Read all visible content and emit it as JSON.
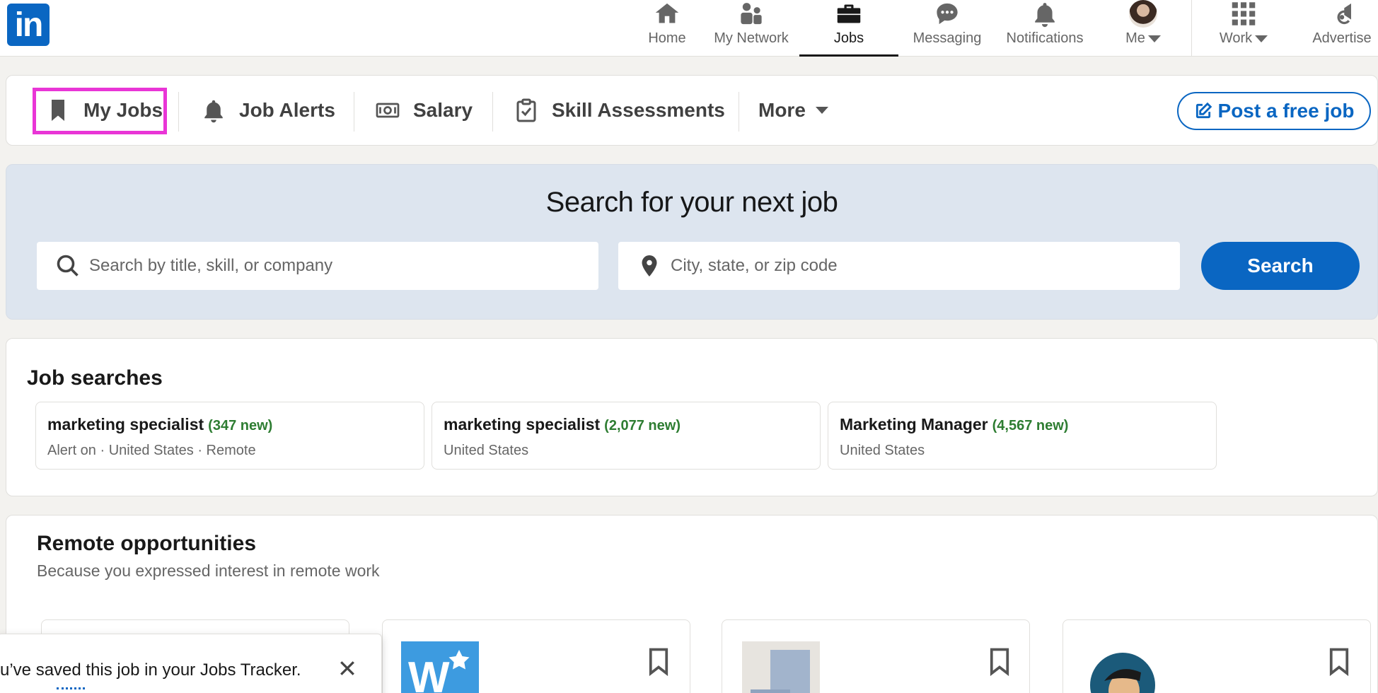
{
  "topnav": {
    "logo": "in",
    "items": [
      {
        "label": "Home",
        "icon": "home-icon"
      },
      {
        "label": "My Network",
        "icon": "network-icon"
      },
      {
        "label": "Jobs",
        "icon": "briefcase-icon"
      },
      {
        "label": "Messaging",
        "icon": "chat-icon"
      },
      {
        "label": "Notifications",
        "icon": "bell-icon"
      },
      {
        "label": "Me",
        "icon": "avatar"
      },
      {
        "label": "Work",
        "icon": "grid-icon"
      },
      {
        "label": "Advertise",
        "icon": "megaphone-icon"
      }
    ],
    "active": "Jobs"
  },
  "subnav": {
    "items": [
      {
        "label": "My Jobs",
        "icon": "bookmark-icon"
      },
      {
        "label": "Job Alerts",
        "icon": "bell-icon"
      },
      {
        "label": "Salary",
        "icon": "money-icon"
      },
      {
        "label": "Skill Assessments",
        "icon": "clipboard-check-icon"
      },
      {
        "label": "More",
        "icon": "caret-down-icon"
      }
    ],
    "post_job_label": "Post a free job"
  },
  "search": {
    "title": "Search for your next job",
    "keyword_placeholder": "Search by title, skill, or company",
    "location_placeholder": "City, state, or zip code",
    "button_label": "Search"
  },
  "job_searches": {
    "title": "Job searches",
    "items": [
      {
        "query": "marketing specialist",
        "new": "(347 new)",
        "detail": "Alert on · United States · Remote"
      },
      {
        "query": "marketing specialist",
        "new": "(2,077 new)",
        "detail": "United States"
      },
      {
        "query": "Marketing Manager",
        "new": "(4,567 new)",
        "detail": "United States"
      }
    ]
  },
  "remote": {
    "title": "Remote opportunities",
    "subtitle": "Because you expressed interest in remote work"
  },
  "toast": {
    "message": "u’ve saved this job in your Jobs Tracker."
  },
  "colors": {
    "brand": "#0a66c2",
    "highlight": "#e935d6",
    "new_count": "#2e7d32",
    "hero_bg": "#dde5ef"
  }
}
